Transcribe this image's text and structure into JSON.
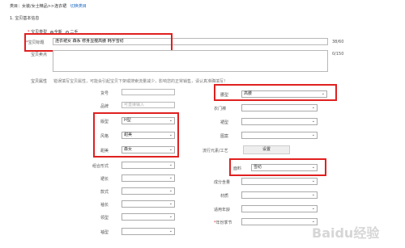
{
  "breadcrumb": {
    "prefix": "类目：",
    "path": "女装/女士精品>>连衣裙",
    "switch_link": "切换类目"
  },
  "section": {
    "title": "1. 宝贝基本信息"
  },
  "product_type": {
    "label": "宝贝类型",
    "option_new": "全新",
    "option_used": "二手"
  },
  "title_field": {
    "label": "宝贝标题",
    "value": "连衣裙女 森系 修身显瘦高腰 韩字雪纺",
    "counter": "38/60"
  },
  "selling_point": {
    "label": "宝贝卖点",
    "counter": "0/150"
  },
  "attributes": {
    "label": "宝贝属性",
    "hint": "错误填写宝贝属性，可能会引起宝贝下架或搜索流量减少，影响您的正常销售，请认真准确填写！",
    "fields": {
      "huohao": {
        "label": "货号",
        "value": ""
      },
      "pinpai": {
        "label": "品牌",
        "placeholder": "可直接输入"
      },
      "banxing": {
        "label": "版型",
        "value": "H型"
      },
      "fengge": {
        "label": "风格",
        "value": "甜美"
      },
      "fengge_sub": {
        "label": "甜美",
        "value": "森女"
      },
      "zhuhe": {
        "label": "组合形式",
        "value": ""
      },
      "qunchang": {
        "label": "裙长",
        "value": ""
      },
      "kuanshi": {
        "label": "款式",
        "value": ""
      },
      "xiuchang": {
        "label": "袖长",
        "value": ""
      },
      "lingxing": {
        "label": "领型",
        "value": ""
      },
      "xiuxing": {
        "label": "袖型",
        "value": ""
      },
      "yaoxing": {
        "label": "腰型",
        "value": "高腰"
      },
      "yimen": {
        "label": "衣门襟",
        "value": ""
      },
      "qunxing": {
        "label": "裙型",
        "value": ""
      },
      "tuan": {
        "label": "图案",
        "value": ""
      },
      "liuxing": {
        "label": "流行元素/工艺",
        "button": "设置"
      },
      "mianliao": {
        "label": "面料",
        "value": "雪纺"
      },
      "chengfen": {
        "label": "成分含量",
        "value": ""
      },
      "caizhi": {
        "label": "材质",
        "value": ""
      },
      "nianling": {
        "label": "适用年龄",
        "value": ""
      },
      "niandu": {
        "label": "年份季节",
        "required_mark": "*",
        "value": ""
      }
    }
  },
  "watermark": "Baidu经验",
  "colors": {
    "highlight": "#e02020",
    "link": "#1a66c0"
  }
}
